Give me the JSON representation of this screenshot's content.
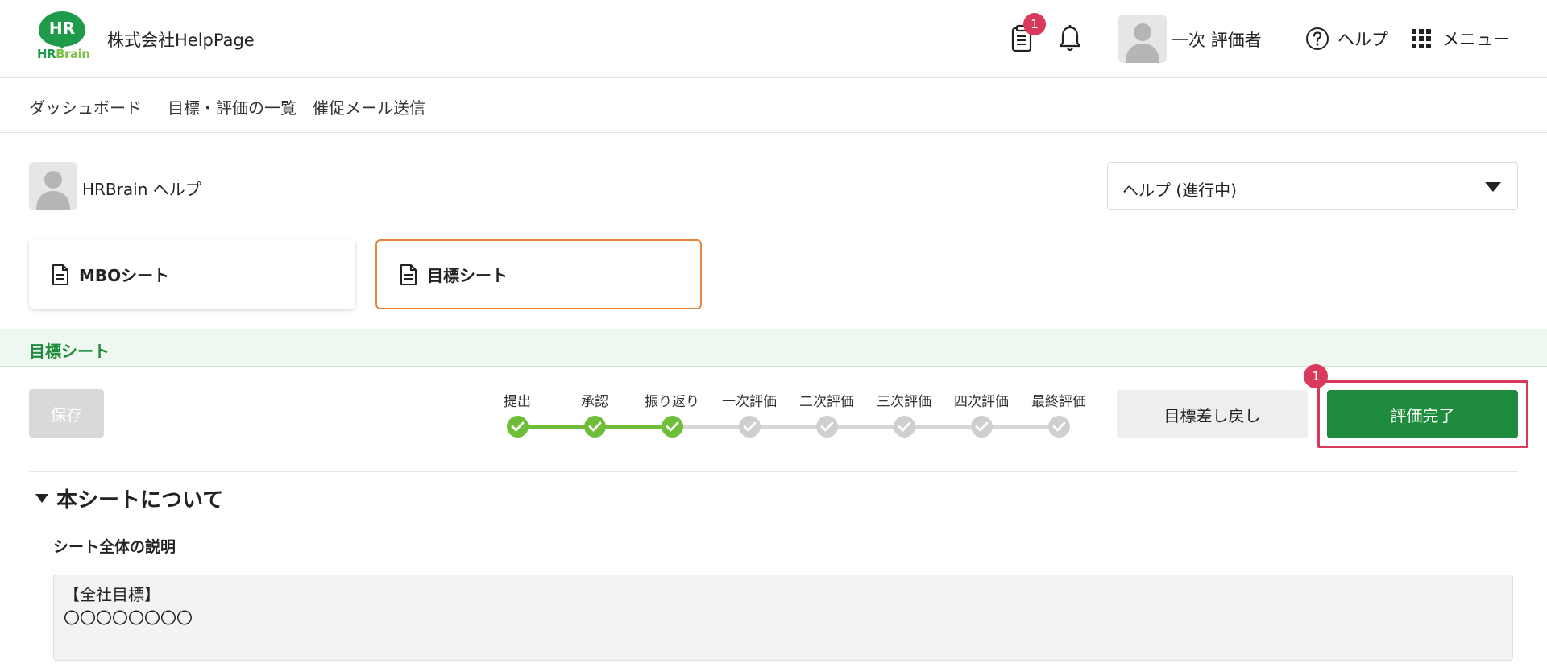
{
  "header": {
    "logo": {
      "mark": "HR",
      "text_hr": "HR",
      "text_brain": "Brain"
    },
    "company": "株式会社HelpPage",
    "clipboard_badge": "1",
    "user_name": "一次 評価者",
    "help_label": "ヘルプ",
    "menu_label": "メニュー"
  },
  "nav": {
    "items": [
      "ダッシュボード",
      "目標・評価の一覧",
      "催促メール送信"
    ]
  },
  "person": {
    "name": "HRBrain ヘルプ",
    "period": "ヘルプ (進行中)"
  },
  "sheets": [
    {
      "label": "MBOシート",
      "active": false
    },
    {
      "label": "目標シート",
      "active": true
    }
  ],
  "section": {
    "title": "目標シート"
  },
  "toolbar": {
    "save_label": "保存",
    "revert_label": "目標差し戻し",
    "complete_label": "評価完了",
    "annotation_badge": "1"
  },
  "steps": [
    {
      "label": "提出",
      "done": true
    },
    {
      "label": "承認",
      "done": true
    },
    {
      "label": "振り返り",
      "done": true
    },
    {
      "label": "一次評価",
      "done": false
    },
    {
      "label": "二次評価",
      "done": false
    },
    {
      "label": "三次評価",
      "done": false
    },
    {
      "label": "四次評価",
      "done": false
    },
    {
      "label": "最終評価",
      "done": false
    }
  ],
  "about": {
    "title": "本シートについて",
    "desc_label": "シート全体の説明",
    "desc_text": "【全社目標】\n〇〇〇〇〇〇〇〇"
  },
  "colors": {
    "brand_green": "#1e8c3c",
    "step_done": "#6fbe3a",
    "step_todo": "#cfcfcf",
    "annotation_red": "#d93a5b",
    "active_card_border": "#e8843a"
  }
}
